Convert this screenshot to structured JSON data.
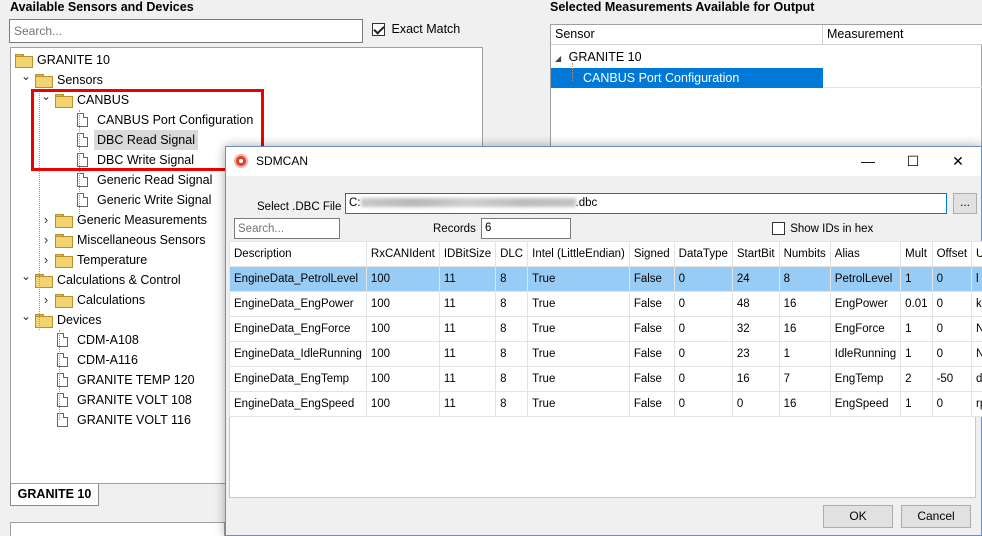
{
  "left_panel": {
    "title": "Available Sensors and Devices",
    "search_placeholder": "Search...",
    "exact_match_label": "Exact Match",
    "tab_label": "GRANITE 10",
    "tree": [
      {
        "label": "GRANITE 10",
        "level": 0,
        "type": "folder",
        "expander": ""
      },
      {
        "label": "Sensors",
        "level": 1,
        "type": "folder",
        "expander": "open"
      },
      {
        "label": "CANBUS",
        "level": 2,
        "type": "folder",
        "expander": "open"
      },
      {
        "label": "CANBUS Port Configuration",
        "level": 3,
        "type": "page",
        "expander": ""
      },
      {
        "label": "DBC Read Signal",
        "level": 3,
        "type": "page",
        "expander": "",
        "selected": true
      },
      {
        "label": "DBC Write Signal",
        "level": 3,
        "type": "page",
        "expander": ""
      },
      {
        "label": "Generic Read Signal",
        "level": 3,
        "type": "page",
        "expander": ""
      },
      {
        "label": "Generic Write Signal",
        "level": 3,
        "type": "page",
        "expander": ""
      },
      {
        "label": "Generic Measurements",
        "level": 2,
        "type": "folder",
        "expander": "closed"
      },
      {
        "label": "Miscellaneous Sensors",
        "level": 2,
        "type": "folder",
        "expander": "closed"
      },
      {
        "label": "Temperature",
        "level": 2,
        "type": "folder",
        "expander": "closed"
      },
      {
        "label": "Calculations & Control",
        "level": 1,
        "type": "folder",
        "expander": "open"
      },
      {
        "label": "Calculations",
        "level": 2,
        "type": "folder",
        "expander": "closed"
      },
      {
        "label": "Devices",
        "level": 1,
        "type": "folder",
        "expander": "open"
      },
      {
        "label": "CDM-A108",
        "level": 2,
        "type": "page",
        "expander": ""
      },
      {
        "label": "CDM-A116",
        "level": 2,
        "type": "page",
        "expander": ""
      },
      {
        "label": "GRANITE TEMP 120",
        "level": 2,
        "type": "page",
        "expander": ""
      },
      {
        "label": "GRANITE VOLT 108",
        "level": 2,
        "type": "page",
        "expander": ""
      },
      {
        "label": "GRANITE VOLT 116",
        "level": 2,
        "type": "page",
        "expander": ""
      }
    ]
  },
  "right_panel": {
    "title": "Selected Measurements Available for Output",
    "col_sensor": "Sensor",
    "col_measurement": "Measurement",
    "device": "GRANITE 10",
    "selected_item": "CANBUS Port Configuration"
  },
  "dialog": {
    "title": "SDMCAN",
    "dbc_label": "Select .DBC File",
    "dbc_prefix": "C:",
    "dbc_suffix": ".dbc",
    "browse_label": "...",
    "search_placeholder": "Search...",
    "records_label": "Records",
    "records_value": "6",
    "show_ids_label": "Show IDs in hex",
    "columns": [
      "Description",
      "RxCANIdent",
      "IDBitSize",
      "DLC",
      "Intel (LittleEndian)",
      "Signed",
      "DataType",
      "StartBit",
      "Numbits",
      "Alias",
      "Mult",
      "Offset",
      "Units"
    ],
    "rows": [
      [
        "EngineData_PetrolLevel",
        "100",
        "11",
        "8",
        "True",
        "False",
        "0",
        "24",
        "8",
        "PetrolLevel",
        "1",
        "0",
        "l"
      ],
      [
        "EngineData_EngPower",
        "100",
        "11",
        "8",
        "True",
        "False",
        "0",
        "48",
        "16",
        "EngPower",
        "0.01",
        "0",
        "kW"
      ],
      [
        "EngineData_EngForce",
        "100",
        "11",
        "8",
        "True",
        "False",
        "0",
        "32",
        "16",
        "EngForce",
        "1",
        "0",
        "N"
      ],
      [
        "EngineData_IdleRunning",
        "100",
        "11",
        "8",
        "True",
        "False",
        "0",
        "23",
        "1",
        "IdleRunning",
        "1",
        "0",
        "None"
      ],
      [
        "EngineData_EngTemp",
        "100",
        "11",
        "8",
        "True",
        "False",
        "0",
        "16",
        "7",
        "EngTemp",
        "2",
        "-50",
        "degC"
      ],
      [
        "EngineData_EngSpeed",
        "100",
        "11",
        "8",
        "True",
        "False",
        "0",
        "0",
        "16",
        "EngSpeed",
        "1",
        "0",
        "rpm"
      ]
    ],
    "ok_label": "OK",
    "cancel_label": "Cancel",
    "minimize_glyph": "—",
    "maximize_glyph": "☐",
    "close_glyph": "✕"
  },
  "colors": {
    "selection_blue": "#0078d7",
    "row_selected": "#99ccf5",
    "highlight_red": "#e00000"
  }
}
